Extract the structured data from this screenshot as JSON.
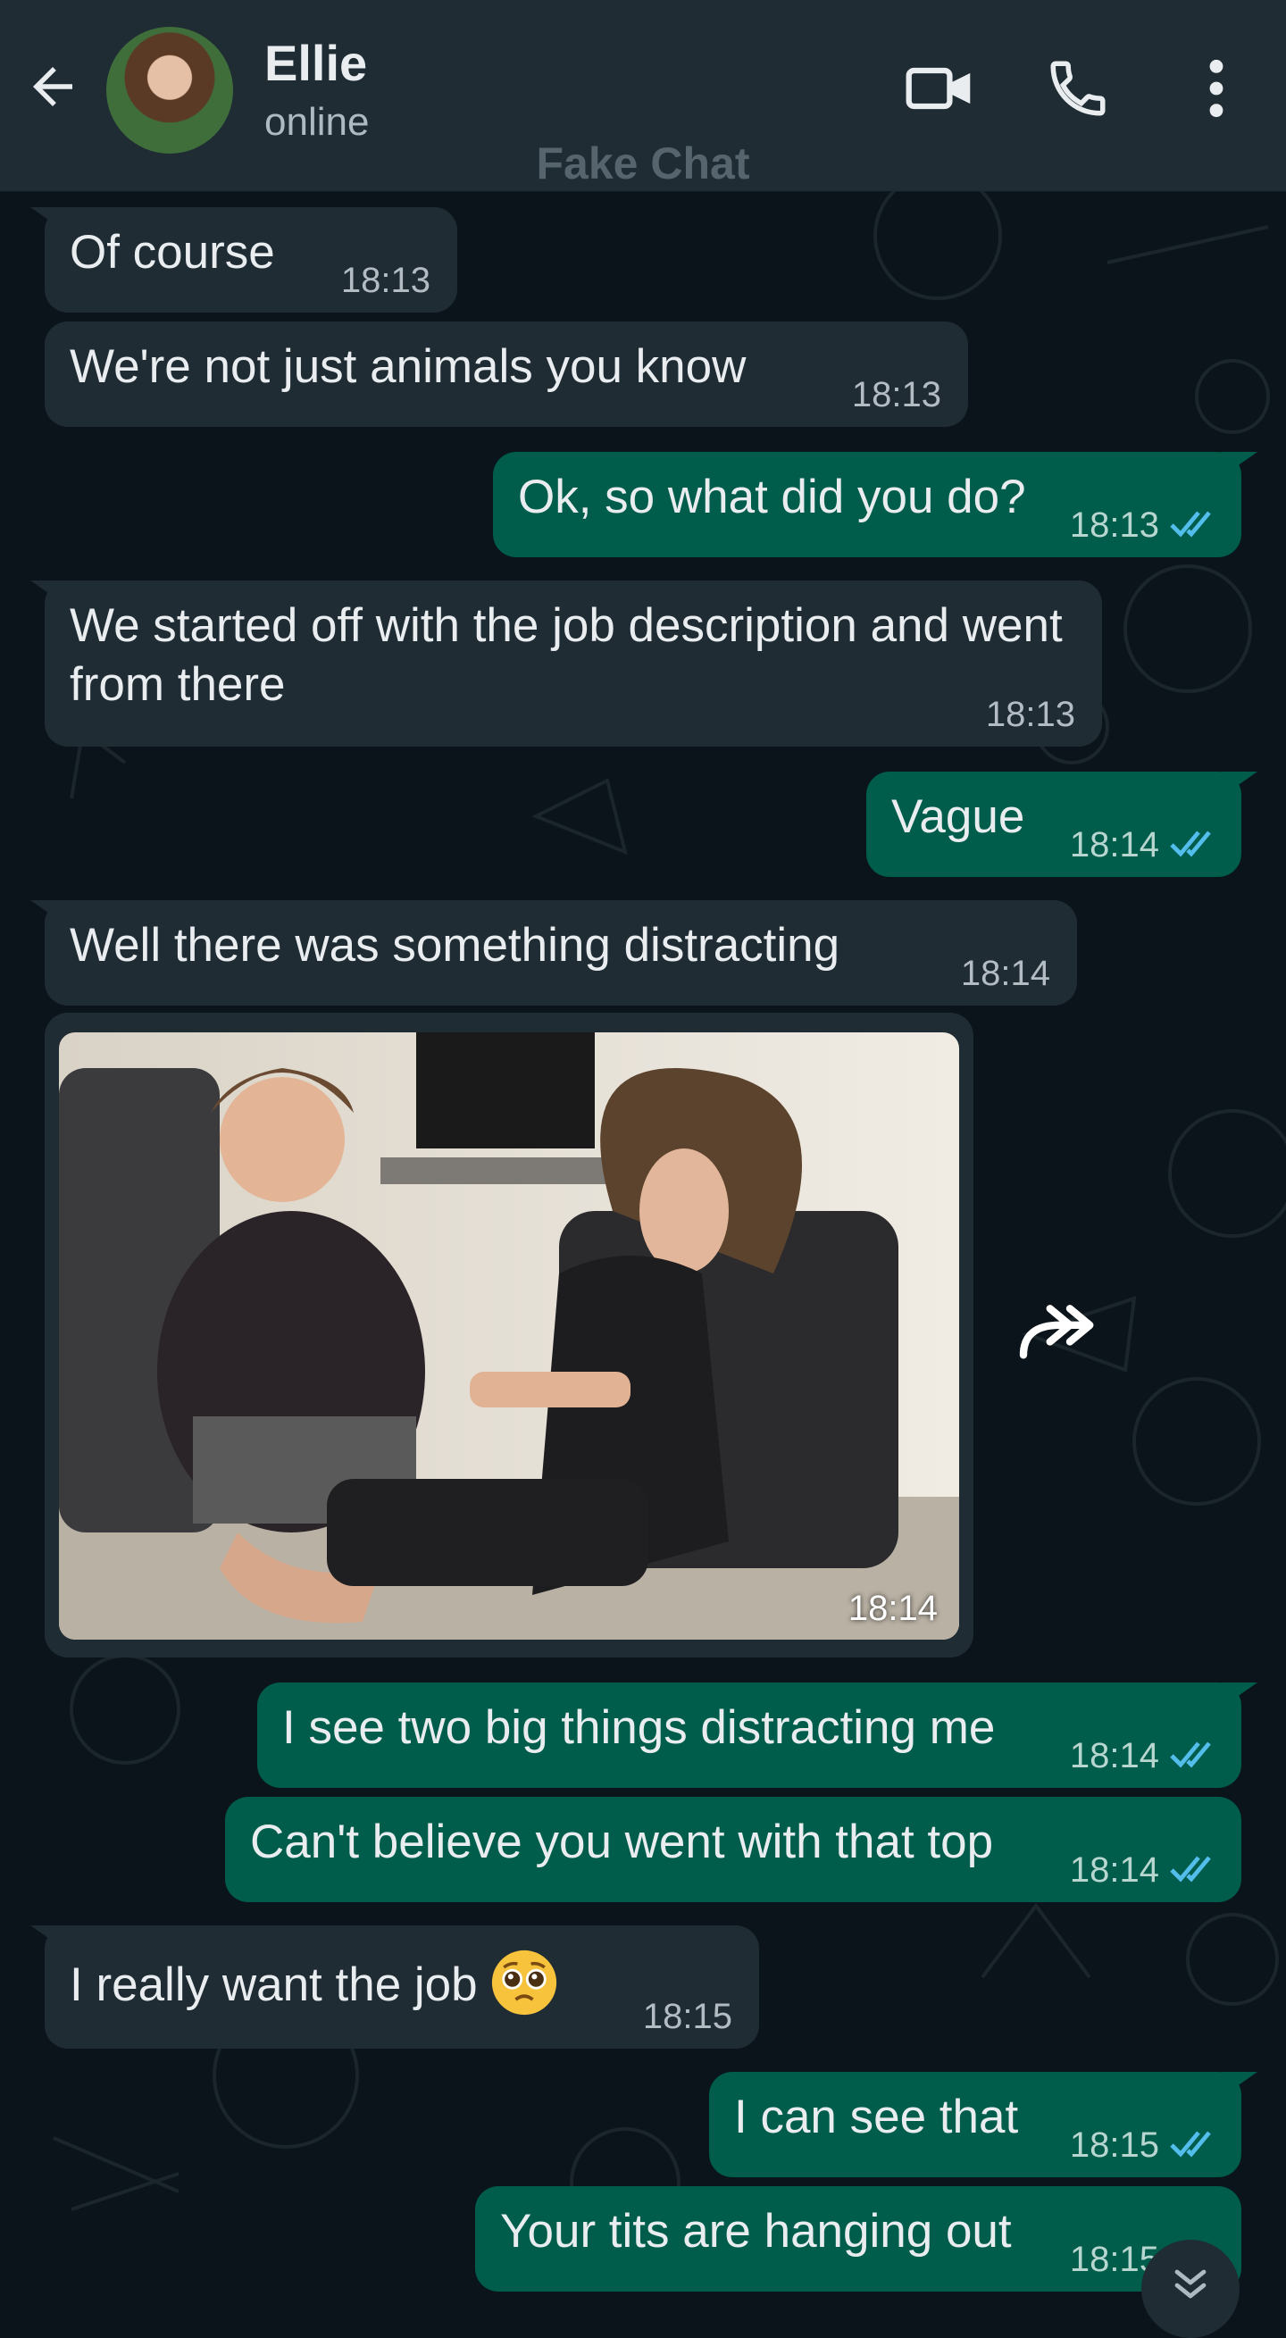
{
  "header": {
    "contact_name": "Ellie",
    "status": "online",
    "watermark": "Fake Chat"
  },
  "colors": {
    "header_bg": "#1f2c34",
    "chat_bg": "#0b141a",
    "incoming_bubble": "#1f2c34",
    "outgoing_bubble": "#005c4b",
    "read_ticks": "#53bdeb"
  },
  "messages": [
    {
      "direction": "in",
      "text": "Of course",
      "time": "18:13"
    },
    {
      "direction": "in",
      "text": "We're not just animals you know",
      "time": "18:13"
    },
    {
      "direction": "out",
      "text": "Ok, so what did you do?",
      "time": "18:13",
      "status": "read"
    },
    {
      "direction": "in",
      "text": "We started off with the job description and went from there",
      "time": "18:13"
    },
    {
      "direction": "out",
      "text": "Vague",
      "time": "18:14",
      "status": "read"
    },
    {
      "direction": "in",
      "text": "Well there was something distracting",
      "time": "18:14"
    },
    {
      "direction": "in",
      "type": "image",
      "time": "18:14"
    },
    {
      "direction": "out",
      "text": "I see two big things distracting me",
      "time": "18:14",
      "status": "read"
    },
    {
      "direction": "out",
      "text": "Can't believe you went with that top",
      "time": "18:14",
      "status": "read"
    },
    {
      "direction": "in",
      "text": "I really want the job",
      "emoji": "pleading-face",
      "time": "18:15"
    },
    {
      "direction": "out",
      "text": "I can see that",
      "time": "18:15",
      "status": "read"
    },
    {
      "direction": "out",
      "text": "Your tits are hanging out",
      "time": "18:15",
      "status": "read"
    }
  ],
  "icons": {
    "back": "back-arrow-icon",
    "video": "video-call-icon",
    "call": "phone-icon",
    "menu": "kebab-menu-icon",
    "forward": "forward-icon",
    "scroll_down": "double-chevron-down-icon",
    "read_status": "double-check-icon"
  }
}
